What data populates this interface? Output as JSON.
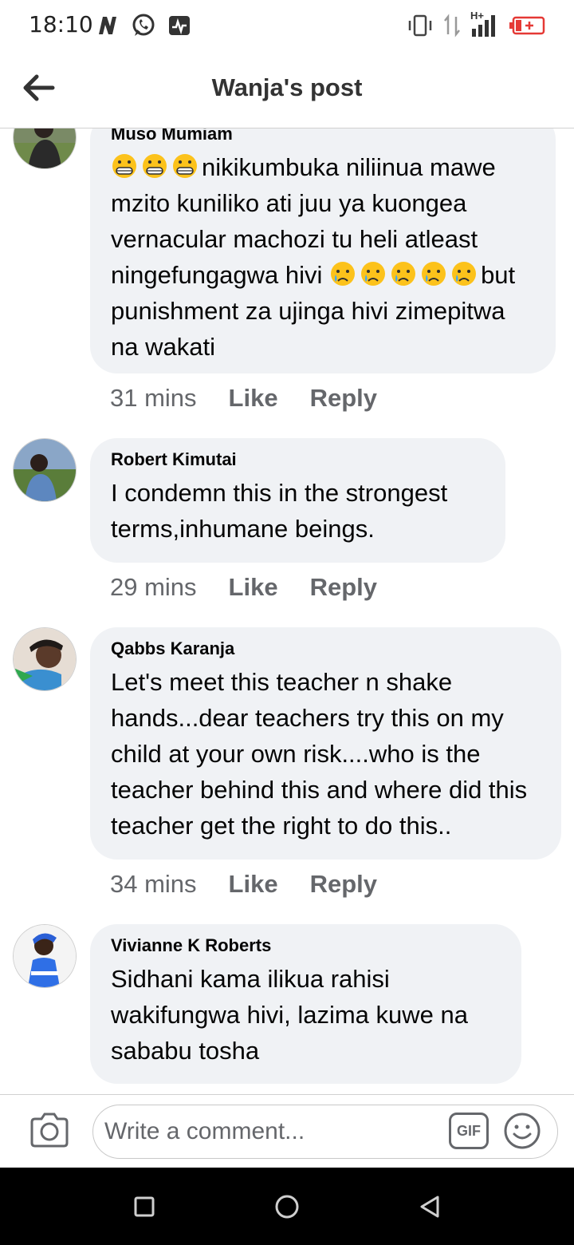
{
  "status_bar": {
    "time": "18:10",
    "network_label": "H+"
  },
  "header": {
    "title": "Wanja's post"
  },
  "comments": [
    {
      "author": "Muso Mumiam",
      "text_line_1": "nikikumbuka niliinua mawe mzito kuniliko ati juu ya kuongea vernacular machozi tu heli atleast ningefungagwa hivi",
      "text_line_2": "but punishment za ujinga hivi zimepitwa na wakati",
      "time": "31 mins",
      "like": "Like",
      "reply": "Reply"
    },
    {
      "author": "Robert Kimutai",
      "text": "I condemn this in the strongest terms,inhumane beings.",
      "time": "29 mins",
      "like": "Like",
      "reply": "Reply"
    },
    {
      "author": "Qabbs Karanja",
      "text": "Let's meet this teacher n shake hands...dear teachers try this on my child at your own risk....who is the teacher behind this and where did this teacher get the right to do this..",
      "time": "34 mins",
      "like": "Like",
      "reply": "Reply"
    },
    {
      "author": "Vivianne K Roberts",
      "text": "Sidhani kama ilikua rahisi wakifungwa hivi, lazima kuwe na sababu tosha"
    }
  ],
  "composer": {
    "placeholder": "Write a comment...",
    "gif_label": "GIF"
  },
  "icons": {
    "back": "arrow-left-icon",
    "camera": "camera-icon",
    "gif": "gif-icon",
    "emoji": "smiley-icon",
    "grimace": "grimacing-face-icon",
    "cry": "crying-face-icon",
    "nav_recent": "square-icon",
    "nav_home": "circle-icon",
    "nav_back": "triangle-back-icon"
  },
  "colors": {
    "bubble": "#f0f2f5",
    "secondary_text": "#65676b",
    "battery": "#e53935"
  }
}
